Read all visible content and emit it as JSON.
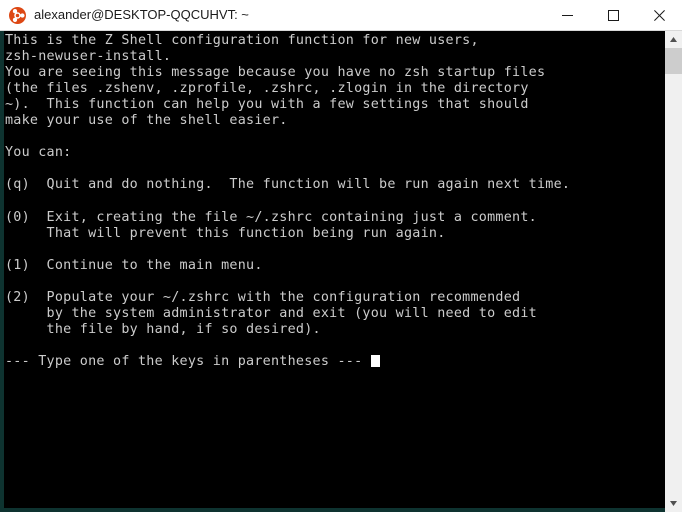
{
  "window": {
    "title": "alexander@DESKTOP-QQCUHVT: ~",
    "app_icon": "ubuntu-icon",
    "colors": {
      "titlebar_bg": "#ffffff",
      "titlebar_text": "#1b1b1b",
      "terminal_bg": "#000000",
      "terminal_text": "#cccccc",
      "window_border": "#0e3330",
      "accent_orange": "#dd4814",
      "scrollbar_track": "#f0f0f0",
      "scrollbar_thumb": "#cdcdcd",
      "cursor": "#ffffff"
    },
    "controls": [
      {
        "name": "minimize-button",
        "glyph": "minimize-icon",
        "label": "Minimize"
      },
      {
        "name": "maximize-button",
        "glyph": "maximize-icon",
        "label": "Maximize"
      },
      {
        "name": "close-button",
        "glyph": "close-icon",
        "label": "Close"
      }
    ]
  },
  "scrollbar": {
    "up_arrow": "chevron-up-icon",
    "down_arrow": "chevron-down-icon",
    "thumb_position_percent": 0
  },
  "terminal": {
    "cursor_visible": true,
    "lines": [
      "This is the Z Shell configuration function for new users,",
      "zsh-newuser-install.",
      "You are seeing this message because you have no zsh startup files",
      "(the files .zshenv, .zprofile, .zshrc, .zlogin in the directory",
      "~).  This function can help you with a few settings that should",
      "make your use of the shell easier.",
      "",
      "You can:",
      "",
      "(q)  Quit and do nothing.  The function will be run again next time.",
      "",
      "(0)  Exit, creating the file ~/.zshrc containing just a comment.",
      "     That will prevent this function being run again.",
      "",
      "(1)  Continue to the main menu.",
      "",
      "(2)  Populate your ~/.zshrc with the configuration recommended",
      "     by the system administrator and exit (you will need to edit",
      "     the file by hand, if so desired).",
      "",
      "--- Type one of the keys in parentheses --- "
    ]
  }
}
